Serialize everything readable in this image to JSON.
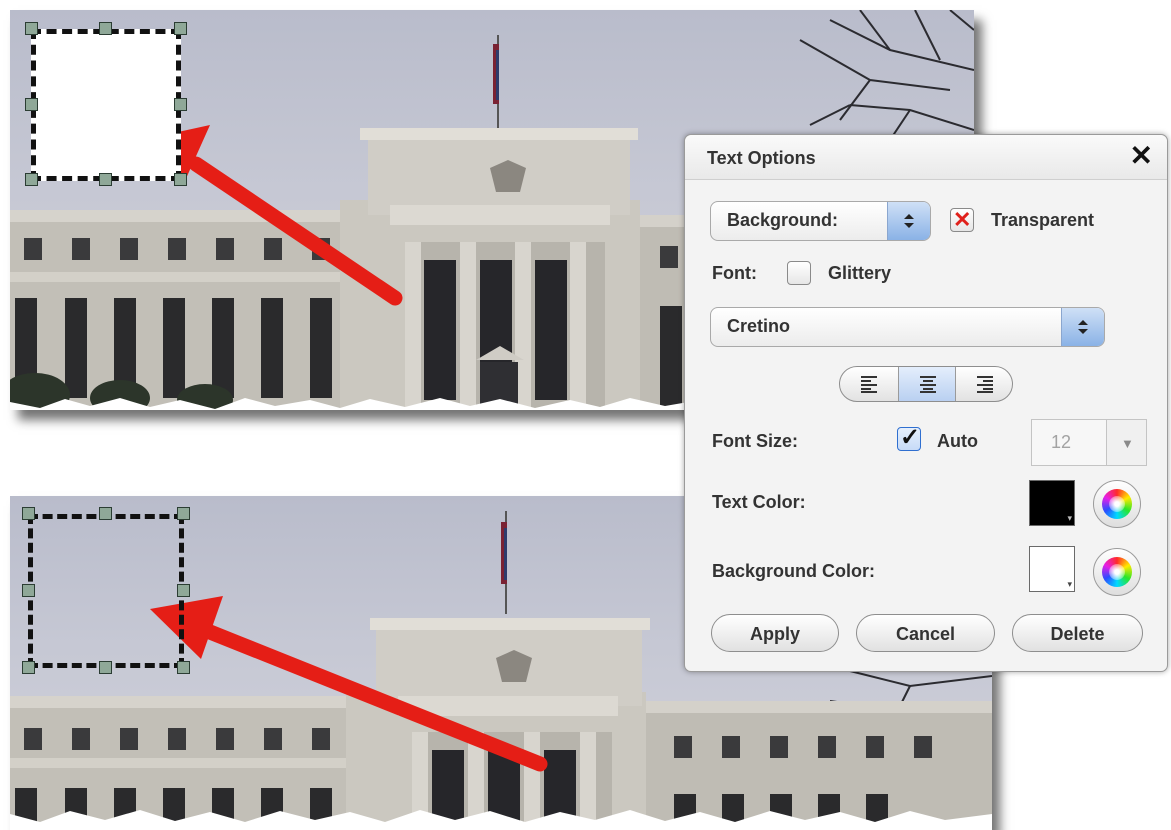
{
  "dialog": {
    "title": "Text Options",
    "close_glyph": "✕",
    "background_select": {
      "value": "Background:"
    },
    "transparent": {
      "label": "Transparent",
      "checked": true,
      "mark_glyph": "✕"
    },
    "font": {
      "label": "Font:",
      "glittery_label": "Glittery",
      "glittery_checked": false
    },
    "font_family_select": {
      "value": "Cretino"
    },
    "alignment": {
      "options": [
        "left",
        "center",
        "right"
      ],
      "selected": "center"
    },
    "font_size": {
      "label": "Font Size:",
      "auto_label": "Auto",
      "auto_checked": true,
      "check_glyph": "✓",
      "value": "12",
      "dropdown_glyph": "▼"
    },
    "text_color": {
      "label": "Text Color:",
      "swatch": "#000000"
    },
    "background_color": {
      "label": "Background Color:",
      "swatch": "#ffffff"
    },
    "buttons": {
      "apply": "Apply",
      "cancel": "Cancel",
      "delete": "Delete"
    }
  },
  "colors": {
    "arrow": "#e51e16",
    "handle": "#8fa898",
    "checkbox_x": "#e0201b",
    "check_blue": "#3b8ef0",
    "stepper_blue": "#8ab2e6"
  }
}
